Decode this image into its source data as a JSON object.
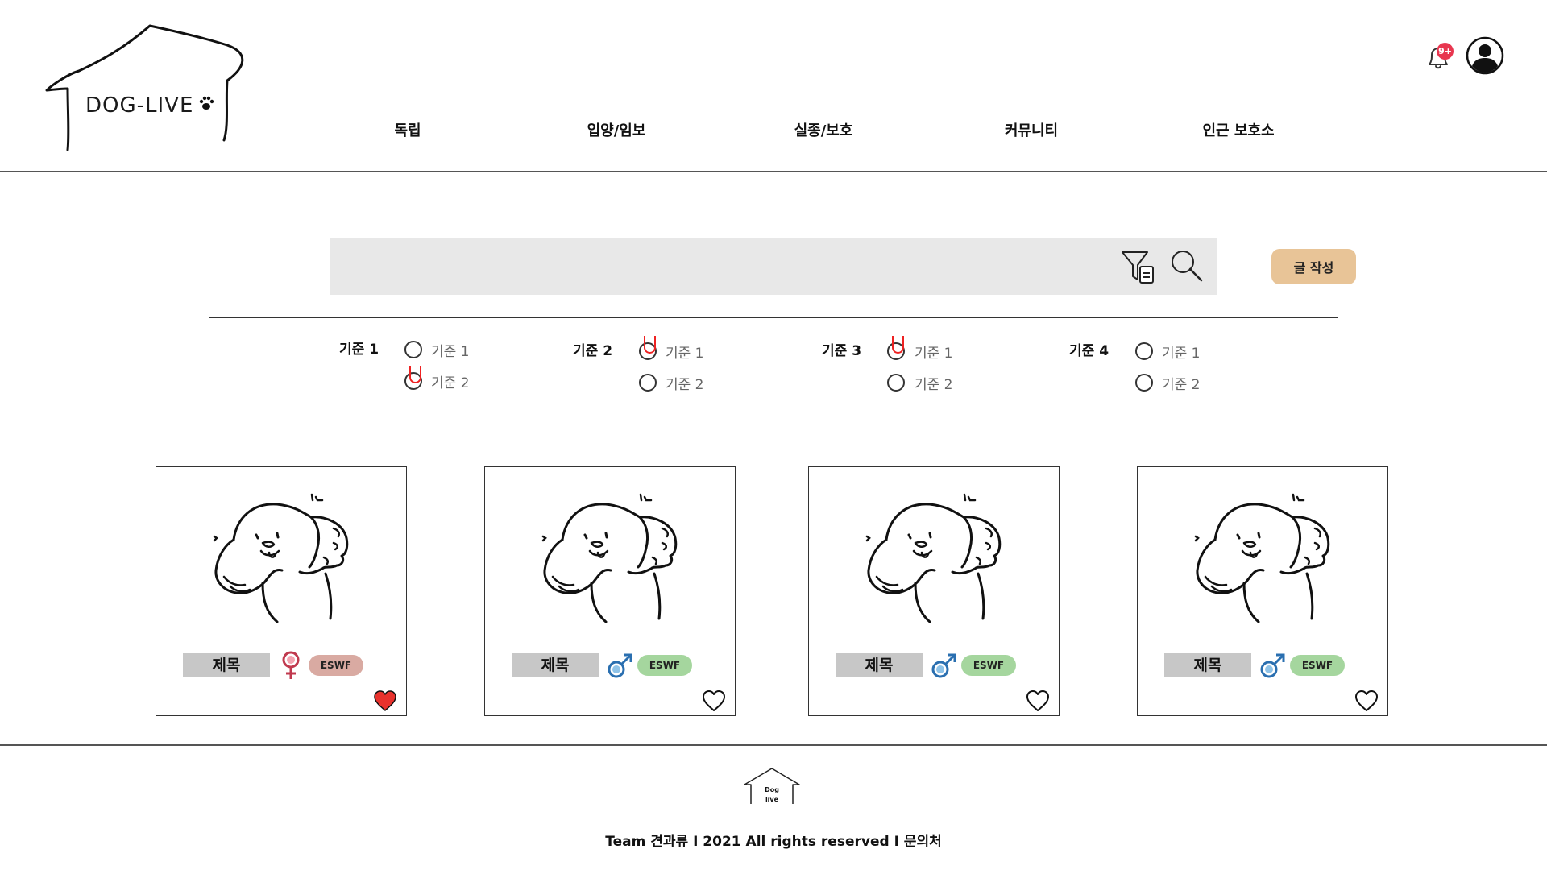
{
  "brand": {
    "name": "DOG-LIVE"
  },
  "nav": [
    "독립",
    "입양/임보",
    "실종/보호",
    "커뮤니티",
    "인근 보호소"
  ],
  "header": {
    "notification_badge": "9+"
  },
  "search": {
    "placeholder": "",
    "write_button": "글 작성"
  },
  "filters": [
    {
      "title": "기준 1",
      "options": [
        {
          "label": "기준 1",
          "checked": false
        },
        {
          "label": "기준 2",
          "checked": true
        }
      ]
    },
    {
      "title": "기준 2",
      "options": [
        {
          "label": "기준 1",
          "checked": true
        },
        {
          "label": "기준 2",
          "checked": false
        }
      ]
    },
    {
      "title": "기준 3",
      "options": [
        {
          "label": "기준 1",
          "checked": true
        },
        {
          "label": "기준 2",
          "checked": false
        }
      ]
    },
    {
      "title": "기준 4",
      "options": [
        {
          "label": "기준 1",
          "checked": false
        },
        {
          "label": "기준 2",
          "checked": false
        }
      ]
    }
  ],
  "cards": [
    {
      "title": "제목",
      "gender": "female",
      "badge": "ESWF",
      "liked": true
    },
    {
      "title": "제목",
      "gender": "male",
      "badge": "ESWF",
      "liked": false
    },
    {
      "title": "제목",
      "gender": "male",
      "badge": "ESWF",
      "liked": false
    },
    {
      "title": "제목",
      "gender": "male",
      "badge": "ESWF",
      "liked": false
    }
  ],
  "colors": {
    "female_badge": "#d9aaa2",
    "male_badge": "#a5d69e",
    "female_symbol": "#e15a6e",
    "male_symbol": "#2a6fb0",
    "liked_heart": "#e8322d",
    "write_button": "#e8c497",
    "search_bar": "#e8e8e8"
  },
  "footer": {
    "logo_text": "Dog live",
    "text": "Team 견과류 I 2021 All rights reserved I 문의처"
  }
}
